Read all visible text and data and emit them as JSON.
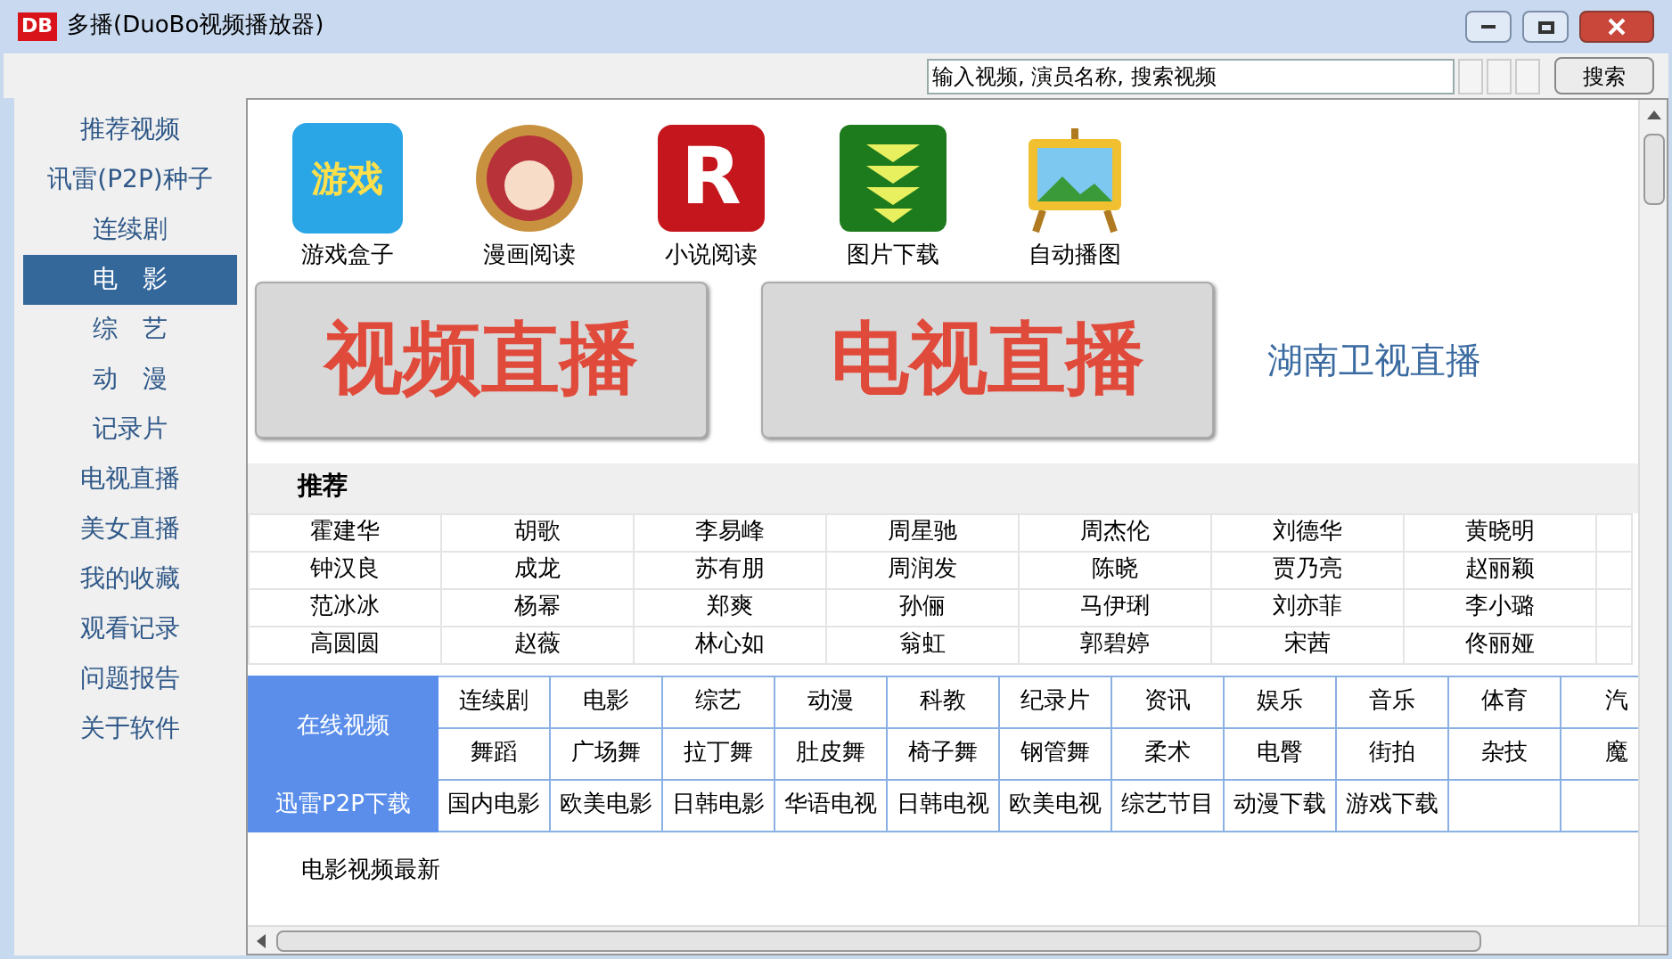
{
  "window": {
    "title": "多播(DuoBo视频播放器)",
    "logo": "DB"
  },
  "search": {
    "placeholder": "输入视频, 演员名称, 搜索视频",
    "button": "搜索"
  },
  "sidebar": {
    "items": [
      {
        "label": "推荐视频",
        "selected": false
      },
      {
        "label": "讯雷(P2P)种子",
        "selected": false
      },
      {
        "label": "连续剧",
        "selected": false
      },
      {
        "label": "电　影",
        "selected": true
      },
      {
        "label": "综　艺",
        "selected": false
      },
      {
        "label": "动　漫",
        "selected": false
      },
      {
        "label": "记录片",
        "selected": false
      },
      {
        "label": "电视直播",
        "selected": false
      },
      {
        "label": "美女直播",
        "selected": false
      },
      {
        "label": "我的收藏",
        "selected": false
      },
      {
        "label": "观看记录",
        "selected": false
      },
      {
        "label": "问题报告",
        "selected": false
      },
      {
        "label": "关于软件",
        "selected": false
      }
    ]
  },
  "apps": [
    {
      "kind": "game",
      "label": "游戏盒子",
      "glyph": "游戏"
    },
    {
      "kind": "avatar",
      "label": "漫画阅读"
    },
    {
      "kind": "letter",
      "label": "小说阅读",
      "glyph": "R"
    },
    {
      "kind": "download",
      "label": "图片下载"
    },
    {
      "kind": "easel",
      "label": "自动播图"
    }
  ],
  "live_buttons": [
    "视频直播",
    "电视直播"
  ],
  "live_link": "湖南卫视直播",
  "recommend": {
    "title": "推荐",
    "rows": [
      [
        "霍建华",
        "胡歌",
        "李易峰",
        "周星驰",
        "周杰伦",
        "刘德华",
        "黄晓明"
      ],
      [
        "钟汉良",
        "成龙",
        "苏有朋",
        "周润发",
        "陈晓",
        "贾乃亮",
        "赵丽颖"
      ],
      [
        "范冰冰",
        "杨幂",
        "郑爽",
        "孙俪",
        "马伊琍",
        "刘亦菲",
        "李小璐"
      ],
      [
        "高圆圆",
        "赵薇",
        "林心如",
        "翁虹",
        "郭碧婷",
        "宋茜",
        "佟丽娅"
      ]
    ]
  },
  "categories": [
    {
      "heading": "在线视频",
      "rows": [
        [
          "连续剧",
          "电影",
          "综艺",
          "动漫",
          "科教",
          "纪录片",
          "资讯",
          "娱乐",
          "音乐",
          "体育",
          "汽"
        ],
        [
          "舞蹈",
          "广场舞",
          "拉丁舞",
          "肚皮舞",
          "椅子舞",
          "钢管舞",
          "柔术",
          "电臀",
          "街拍",
          "杂技",
          "魔"
        ]
      ]
    },
    {
      "heading": "迅雷P2P下载",
      "rows": [
        [
          "国内电影",
          "欧美电影",
          "日韩电影",
          "华语电视",
          "日韩电视",
          "欧美电视",
          "综艺节目",
          "动漫下载",
          "游戏下载",
          "",
          ""
        ]
      ]
    }
  ],
  "latest_title": "电影视频最新"
}
